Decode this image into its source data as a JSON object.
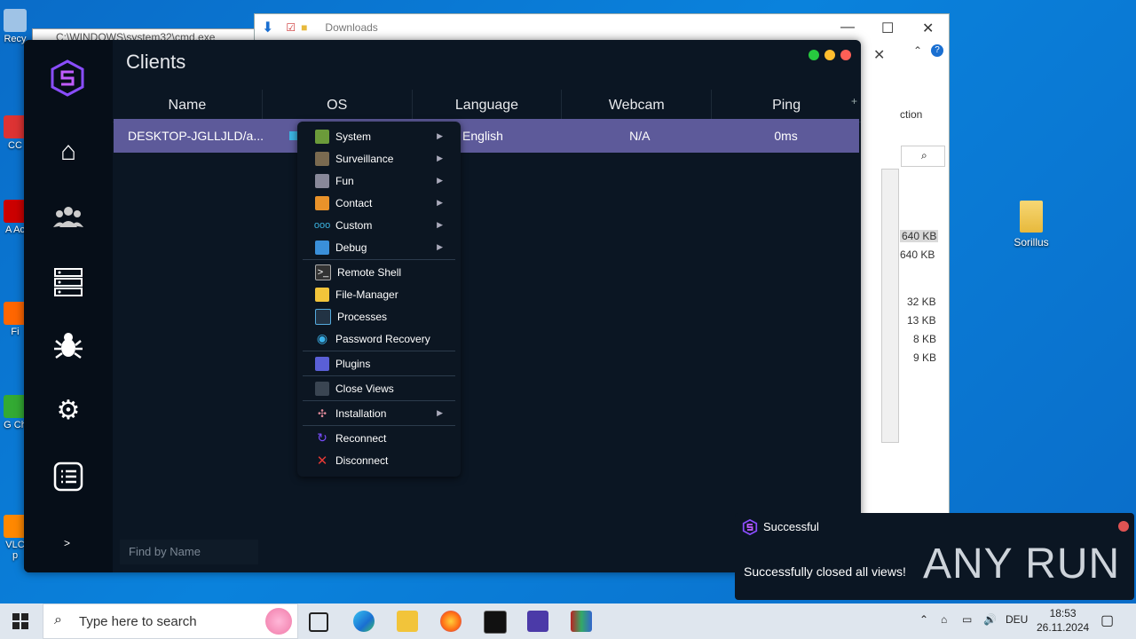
{
  "desktop": {
    "left_icons": [
      "Recy",
      "CC",
      "A Ac",
      "Fi",
      "G Ch",
      "VLC p"
    ],
    "sorillus_label": "Sorillus"
  },
  "cmd_title": "C:\\WINDOWS\\system32\\cmd.exe",
  "explorer": {
    "path": "Downloads",
    "ribbon_text": "ction",
    "sizes": [
      "640 KB",
      "640 KB",
      "32 KB",
      "13 KB",
      "8 KB",
      "9 KB"
    ]
  },
  "app": {
    "title": "Clients",
    "columns": [
      "Name",
      "OS",
      "Language",
      "Webcam",
      "Ping"
    ],
    "row": {
      "name": "DESKTOP-JGLLJLD/a...",
      "language": "English",
      "webcam": "N/A",
      "ping": "0ms"
    },
    "search_placeholder": "Find by Name",
    "collapse_label": ">"
  },
  "context_menu": {
    "groups": [
      [
        "System",
        "Surveillance",
        "Fun",
        "Contact",
        "Custom",
        "Debug"
      ],
      [
        "Remote Shell",
        "File-Manager",
        "Processes",
        "Password Recovery"
      ],
      [
        "Plugins"
      ],
      [
        "Close Views"
      ],
      [
        "Installation"
      ],
      [
        "Reconnect",
        "Disconnect"
      ]
    ]
  },
  "toast": {
    "title": "Successful",
    "message": "Successfully closed all views!"
  },
  "watermark": "ANY RUN",
  "taskbar": {
    "search_placeholder": "Type here to search",
    "language": "DEU",
    "time": "18:53",
    "date": "26.11.2024"
  },
  "colors": {
    "selected_row": "#5d5a9a",
    "accent_purple": "#7b4dff",
    "dot_green": "#27c93f",
    "dot_yellow": "#ffbd2e",
    "dot_red": "#ff5f56"
  }
}
